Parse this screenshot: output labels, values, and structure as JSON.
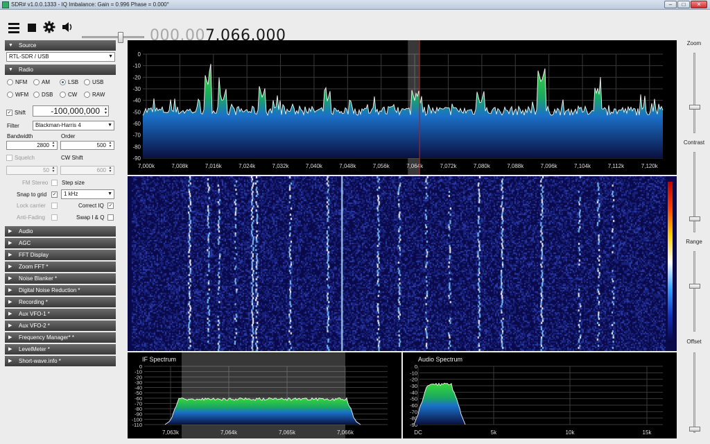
{
  "window": {
    "title": "SDR# v1.0.0.1333 - IQ Imbalance: Gain = 0.996 Phase = 0.000°",
    "min": "–",
    "max": "□",
    "close": "✕"
  },
  "toolbar": {
    "icons": [
      "menu-icon",
      "stop-icon",
      "gear-icon",
      "speaker-icon"
    ],
    "volume": 0.62,
    "freq_dim": "000.00",
    "freq_main": "7.066.000"
  },
  "left": {
    "source": {
      "header": "Source",
      "device": "RTL-SDR / USB"
    },
    "radio": {
      "header": "Radio",
      "modes": [
        {
          "label": "NFM",
          "on": false
        },
        {
          "label": "AM",
          "on": false
        },
        {
          "label": "LSB",
          "on": true
        },
        {
          "label": "USB",
          "on": false
        },
        {
          "label": "WFM",
          "on": false
        },
        {
          "label": "DSB",
          "on": false
        },
        {
          "label": "CW",
          "on": false
        },
        {
          "label": "RAW",
          "on": false
        }
      ],
      "shift_label": "Shift",
      "shift_checked": true,
      "shift_value": "-100,000,000",
      "filter_label": "Filter",
      "filter_value": "Blackman-Harris 4",
      "bandwidth_label": "Bandwidth",
      "bandwidth_value": "2800",
      "order_label": "Order",
      "order_value": "500",
      "squelch_label": "Squelch",
      "squelch_value": "50",
      "cwshift_label": "CW Shift",
      "cwshift_value": "600",
      "fmstereo_label": "FM Stereo",
      "stepsize_label": "Step size",
      "snap_label": "Snap to grid",
      "snap_value": "1 kHz",
      "lockcarrier_label": "Lock carrier",
      "correctiq_label": "Correct IQ",
      "antifading_label": "Anti-Fading",
      "swapiq_label": "Swap I & Q"
    },
    "sections": [
      "Audio",
      "AGC",
      "FFT Display",
      "Zoom FFT *",
      "Noise Blanker *",
      "Digital Noise Reduction *",
      "Recording *",
      "Aux VFO-1 *",
      "Aux VFO-2 *",
      "Frequency Manager* *",
      "LevelMeter *",
      "Short-wave.info *"
    ]
  },
  "right": {
    "zoom": "Zoom",
    "contrast": "Contrast",
    "range": "Range",
    "offset": "Offset"
  },
  "colors": {
    "panel_bg": "#000000",
    "spectrum_fill_top": "#2fc832",
    "spectrum_fill_bottom": "#0a1040",
    "waterfall_bg": "#0a0a4a",
    "vfo_line": "#d01010",
    "header_bg": "#4a4a4a"
  },
  "chart_data": [
    {
      "type": "area",
      "name": "main-spectrum",
      "ylabels": [
        "0",
        "-10",
        "-20",
        "-30",
        "-40",
        "-50",
        "-60",
        "-70",
        "-80",
        "-90"
      ],
      "ylim": [
        -90,
        0
      ],
      "xlabels": [
        "7,000k",
        "7,008k",
        "7,016k",
        "7,024k",
        "7,032k",
        "7,040k",
        "7,048k",
        "7,056k",
        "7,064k",
        "7,072k",
        "7,080k",
        "7,088k",
        "7,096k",
        "7,104k",
        "7,112k",
        "7,120k"
      ],
      "xlim_khz": [
        7000,
        7124
      ],
      "noise_floor_db": -49,
      "peaks_khz_db": [
        [
          7015.5,
          -27
        ],
        [
          7019.0,
          -42
        ],
        [
          7028.5,
          -38
        ],
        [
          7044.0,
          -41
        ],
        [
          7065.0,
          -43
        ],
        [
          7080.5,
          -44
        ],
        [
          7095.0,
          -25
        ],
        [
          7108.5,
          -39
        ]
      ],
      "vfo_khz": 7066,
      "passband_khz": [
        7063.2,
        7066.0
      ],
      "grid": true
    },
    {
      "type": "area",
      "name": "if-spectrum",
      "title": "IF Spectrum",
      "ylabels": [
        "0",
        "-10",
        "-20",
        "-30",
        "-40",
        "-50",
        "-60",
        "-70",
        "-80",
        "-90",
        "-100",
        "-110"
      ],
      "ylim": [
        -110,
        0
      ],
      "xlabels": [
        "7,063k",
        "7,064k",
        "7,065k",
        "7,066k"
      ],
      "level_db": -62,
      "grid": true
    },
    {
      "type": "area",
      "name": "audio-spectrum",
      "title": "Audio Spectrum",
      "ylabels": [
        "0",
        "-10",
        "-20",
        "-30",
        "-40",
        "-50",
        "-60",
        "-70",
        "-80",
        "-90"
      ],
      "ylim": [
        -90,
        0
      ],
      "xlabels": [
        "DC",
        "5k",
        "10k",
        "15k"
      ],
      "level_db": -28,
      "band_khz": [
        0,
        2.8
      ],
      "grid": true
    }
  ]
}
